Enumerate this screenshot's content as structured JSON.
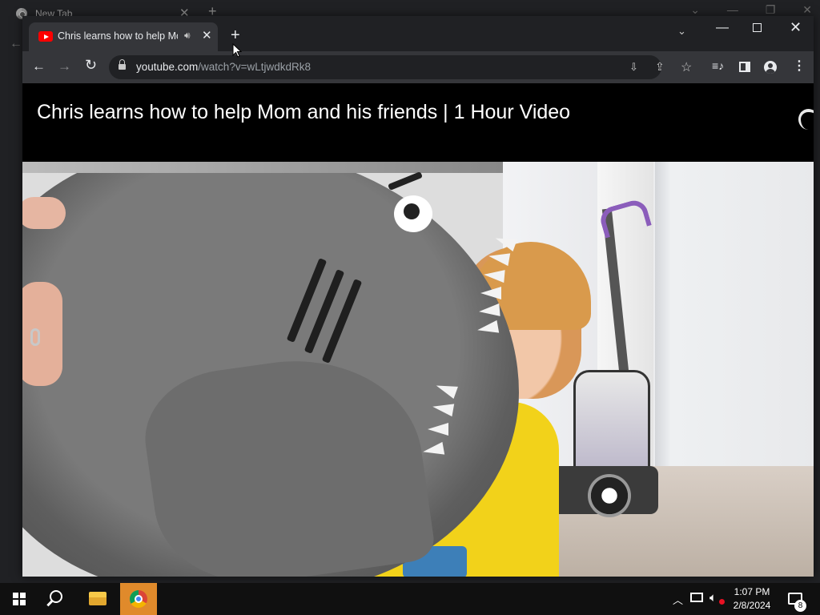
{
  "background_window": {
    "tab_title": "New Tab"
  },
  "browser": {
    "active_tab": {
      "title": "Chris learns how to help Mom and his friends | 1 Hour Video",
      "audio_icon": "speaker-icon"
    },
    "url": {
      "host": "youtube.com",
      "path": "/watch?v=wLtjwdkdRk8"
    }
  },
  "page": {
    "video_title": "Chris learns how to help Mom and his friends | 1 Hour Video"
  },
  "taskbar": {
    "time": "1:07 PM",
    "date": "2/8/2024",
    "notification_count": "8"
  },
  "colors": {
    "chrome_dark": "#202124",
    "toolbar": "#35363a",
    "youtube_red": "#ff0000",
    "taskbar_active": "#e08a2b"
  }
}
